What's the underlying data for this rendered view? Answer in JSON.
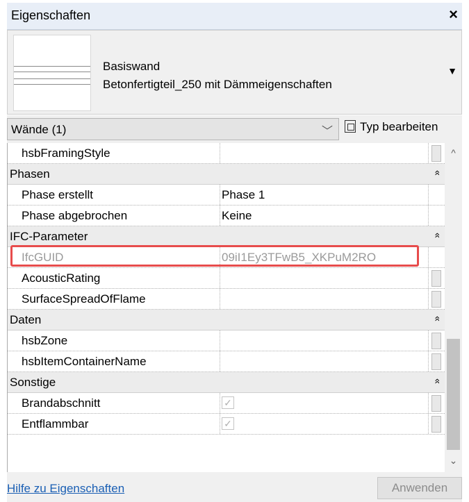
{
  "window": {
    "title": "Eigenschaften",
    "close_icon": "×"
  },
  "type_selector": {
    "category": "Basiswand",
    "type_name": "Betonfertigteil_250 mit Dämmeigenschaften",
    "dropdown_icon": "▼"
  },
  "filter": {
    "selected": "Wände (1)",
    "chevron": "﹀"
  },
  "type_edit": {
    "label": "Typ bearbeiten"
  },
  "rows": [
    {
      "kind": "param",
      "name": "hsbFramingStyle",
      "value": ""
    },
    {
      "kind": "group",
      "name": "Phasen"
    },
    {
      "kind": "param",
      "name": "Phase erstellt",
      "value": "Phase 1"
    },
    {
      "kind": "param",
      "name": "Phase abgebrochen",
      "value": "Keine"
    },
    {
      "kind": "group",
      "name": "IFC-Parameter"
    },
    {
      "kind": "param",
      "name": "IfcGUID",
      "value": "09iI1Ey3TFwB5_XKPuM2RO",
      "dim": true
    },
    {
      "kind": "param",
      "name": "AcousticRating",
      "value": ""
    },
    {
      "kind": "param",
      "name": "SurfaceSpreadOfFlame",
      "value": ""
    },
    {
      "kind": "group",
      "name": "Daten"
    },
    {
      "kind": "param",
      "name": "hsbZone",
      "value": ""
    },
    {
      "kind": "param",
      "name": "hsbItemContainerName",
      "value": ""
    },
    {
      "kind": "group",
      "name": "Sonstige"
    },
    {
      "kind": "param",
      "name": "Brandabschnitt",
      "value": "",
      "checkbox": true
    },
    {
      "kind": "param",
      "name": "Entflammbar",
      "value": "",
      "checkbox": true
    }
  ],
  "footer": {
    "help_link": "Hilfe zu Eigenschaften",
    "apply_label": "Anwenden"
  },
  "colors": {
    "highlight": "#e74c4c",
    "link": "#1a5fb4"
  }
}
